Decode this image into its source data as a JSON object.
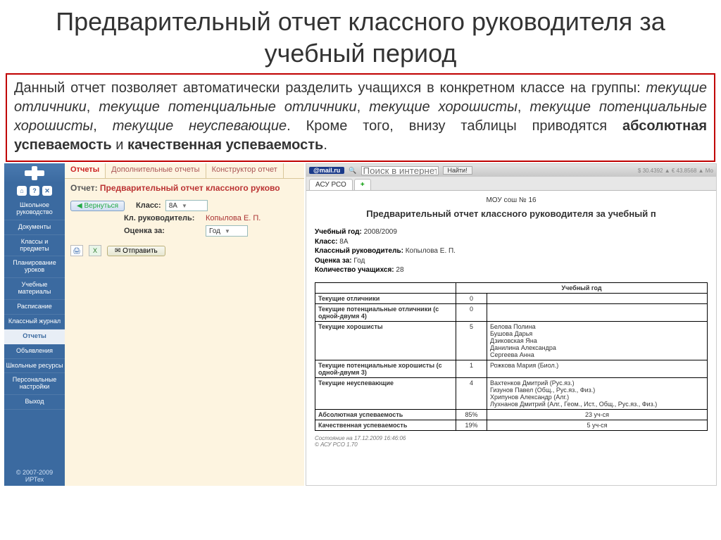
{
  "slide": {
    "title": "Предварительный отчет классного руководителя за учебный период",
    "description_parts": {
      "p1": "Данный отчет позволяет автоматически разделить учащихся в конкретном классе на группы: ",
      "g1": "текущие отличники",
      "g2": "текущие потенциальные отличники",
      "g3": "текущие хорошисты",
      "g4": "текущие потенциальные хорошисты",
      "g5": "текущие неуспевающие",
      "p2": ". Кроме того, внизу таблицы приводятся ",
      "b1": "абсолютная успеваемость",
      "and": " и ",
      "b2": "качественная успеваемость",
      "dot": "."
    }
  },
  "sidebar": {
    "icons": {
      "home": "⌂",
      "help": "?",
      "close": "✕"
    },
    "items": [
      {
        "label": "Школьное руководство"
      },
      {
        "label": "Документы"
      },
      {
        "label": "Классы и предметы"
      },
      {
        "label": "Планирование уроков"
      },
      {
        "label": "Учебные материалы"
      },
      {
        "label": "Расписание"
      },
      {
        "label": "Классный журнал"
      },
      {
        "label": "Отчеты",
        "active": true
      },
      {
        "label": "Объявления"
      },
      {
        "label": "Школьные ресурсы"
      },
      {
        "label": "Персональные настройки"
      },
      {
        "label": "Выход"
      }
    ],
    "footer": "© 2007-2009 ИРТех"
  },
  "tabs": [
    {
      "label": "Отчеты",
      "active": true
    },
    {
      "label": "Дополнительные отчеты"
    },
    {
      "label": "Конструктор отчет"
    }
  ],
  "report_line": {
    "label": "Отчет:",
    "name": "Предварительный отчет классного руково"
  },
  "filters": {
    "back": "Вернуться",
    "class_label": "Класс:",
    "class_value": "8А",
    "teacher_label": "Кл. руководитель:",
    "teacher_value": "Копылова Е. П.",
    "grade_label": "Оценка за:",
    "grade_value": "Год",
    "send": "Отправить"
  },
  "mailbar": {
    "logo": "@mail.ru",
    "search_placeholder": "Поиск в интернете",
    "find": "Найти!",
    "currencies": "$ 30.4392 ▲  € 43.8568 ▲  Мо"
  },
  "righttab": {
    "label": "АСУ РСО",
    "plus": "+"
  },
  "doc": {
    "school": "МОУ сош № 16",
    "title": "Предварительный отчет классного руководителя за учебный п",
    "meta": {
      "year_label": "Учебный год:",
      "year": "2008/2009",
      "class_label": "Класс:",
      "class": "8А",
      "teacher_label": "Классный руководитель:",
      "teacher": "Копылова Е. П.",
      "grade_label": "Оценка за:",
      "grade": "Год",
      "count_label": "Количество учащихся:",
      "count": "28"
    },
    "year_col": "Учебный год",
    "rows": [
      {
        "cat": "Текущие отличники",
        "count": "0",
        "names": ""
      },
      {
        "cat": "Текущие потенциальные отличники (с одной-двумя 4)",
        "count": "0",
        "names": ""
      },
      {
        "cat": "Текущие хорошисты",
        "count": "5",
        "names": "Белова Полина\nБушова Дарья\nДзиковская Яна\nДанилина Александра\nСергеева Анна"
      },
      {
        "cat": "Текущие потенциальные хорошисты (с одной-двумя 3)",
        "count": "1",
        "names": "Рожкова Мария (Биол.)"
      },
      {
        "cat": "Текущие неуспевающие",
        "count": "4",
        "names": "Вахтенков Дмитрий (Рус.яз.)\nГизунов Павел (Общ., Рус.яз., Физ.)\nХрипунов Александр (Алг.)\nЛухнанов Дмитрий (Алг., Геом., Ист., Общ., Рус.яз., Физ.)"
      }
    ],
    "summary": [
      {
        "cat": "Абсолютная успеваемость",
        "pct": "85%",
        "names": "23 уч-ся"
      },
      {
        "cat": "Качественная успеваемость",
        "pct": "19%",
        "names": "5 уч-ся"
      }
    ],
    "footer1": "Состояние на 17.12.2009 16:46:06",
    "footer2": "© АСУ РСО 1.70"
  }
}
